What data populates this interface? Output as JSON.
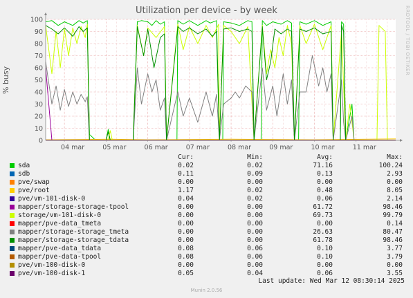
{
  "title": "Utilization per device - by week",
  "side_label": "RRDTOOL / TOBI OETIKER",
  "legend_headers": {
    "cur": "Cur:",
    "min": "Min:",
    "avg": "Avg:",
    "max": "Max:"
  },
  "legend": [
    {
      "name": "sda",
      "color": "#00cc00",
      "cur": "0.02",
      "min": "0.02",
      "avg": "71.16",
      "max": "100.24"
    },
    {
      "name": "sdb",
      "color": "#0066b3",
      "cur": "0.11",
      "min": "0.09",
      "avg": "0.13",
      "max": "2.93"
    },
    {
      "name": "pve/swap",
      "color": "#ff8000",
      "cur": "0.00",
      "min": "0.00",
      "avg": "0.00",
      "max": "0.00"
    },
    {
      "name": "pve/root",
      "color": "#ffcc00",
      "cur": "1.17",
      "min": "0.02",
      "avg": "0.48",
      "max": "8.05"
    },
    {
      "name": "pve/vm-101-disk-0",
      "color": "#330099",
      "cur": "0.04",
      "min": "0.02",
      "avg": "0.06",
      "max": "2.14"
    },
    {
      "name": "mapper/storage-storage-tpool",
      "color": "#990099",
      "cur": "0.00",
      "min": "0.00",
      "avg": "61.72",
      "max": "98.46"
    },
    {
      "name": "storage/vm-101-disk-0",
      "color": "#ccff00",
      "cur": "0.00",
      "min": "0.00",
      "avg": "69.73",
      "max": "99.79"
    },
    {
      "name": "mapper/pve-data_tmeta",
      "color": "#ff0000",
      "cur": "0.00",
      "min": "0.00",
      "avg": "0.00",
      "max": "0.14"
    },
    {
      "name": "mapper/storage-storage_tmeta",
      "color": "#808080",
      "cur": "0.00",
      "min": "0.00",
      "avg": "26.63",
      "max": "80.47"
    },
    {
      "name": "mapper/storage-storage_tdata",
      "color": "#008f00",
      "cur": "0.00",
      "min": "0.00",
      "avg": "61.78",
      "max": "98.46"
    },
    {
      "name": "mapper/pve-data_tdata",
      "color": "#00487d",
      "cur": "0.08",
      "min": "0.06",
      "avg": "0.10",
      "max": "3.77"
    },
    {
      "name": "mapper/pve-data-tpool",
      "color": "#b35a00",
      "cur": "0.08",
      "min": "0.06",
      "avg": "0.10",
      "max": "3.79"
    },
    {
      "name": "pve/vm-100-disk-0",
      "color": "#b38f00",
      "cur": "0.00",
      "min": "0.00",
      "avg": "0.00",
      "max": "0.00"
    },
    {
      "name": "pve/vm-100-disk-1",
      "color": "#6b006b",
      "cur": "0.05",
      "min": "0.04",
      "avg": "0.06",
      "max": "3.55"
    }
  ],
  "last_update": "Last update: Wed Mar 12 08:30:14 2025",
  "footer": "Munin 2.0.56",
  "chart_data": {
    "type": "line",
    "title": "Utilization per device - by week",
    "ylabel": "% busy",
    "ylim": [
      0,
      100
    ],
    "yticks": [
      0,
      10,
      20,
      30,
      40,
      50,
      60,
      70,
      80,
      90,
      100
    ],
    "xlim": [
      3.55,
      11.95
    ],
    "xticks": [
      {
        "label": "04 mar",
        "x": 4
      },
      {
        "label": "05 mar",
        "x": 5
      },
      {
        "label": "06 mar",
        "x": 6
      },
      {
        "label": "07 mar",
        "x": 7
      },
      {
        "label": "08 mar",
        "x": 8
      },
      {
        "label": "09 mar",
        "x": 9
      },
      {
        "label": "10 mar",
        "x": 10
      },
      {
        "label": "11 mar",
        "x": 11
      }
    ],
    "grid": true,
    "series": [
      {
        "name": "sda",
        "color": "#00cc00",
        "points": [
          [
            3.55,
            98
          ],
          [
            3.7,
            99
          ],
          [
            3.85,
            95
          ],
          [
            4.0,
            98
          ],
          [
            4.2,
            95
          ],
          [
            4.35,
            99
          ],
          [
            4.45,
            97
          ],
          [
            4.55,
            99
          ],
          [
            4.6,
            5
          ],
          [
            4.75,
            0
          ],
          [
            4.9,
            0
          ],
          [
            5.0,
            0
          ],
          [
            5.05,
            9
          ],
          [
            5.1,
            0
          ],
          [
            5.4,
            0
          ],
          [
            5.65,
            0
          ],
          [
            5.75,
            98
          ],
          [
            5.85,
            99
          ],
          [
            6.0,
            98
          ],
          [
            6.1,
            95
          ],
          [
            6.2,
            99
          ],
          [
            6.3,
            96
          ],
          [
            6.4,
            98
          ],
          [
            6.45,
            0
          ],
          [
            6.7,
            0
          ],
          [
            6.72,
            99
          ],
          [
            6.85,
            96
          ],
          [
            7.0,
            99
          ],
          [
            7.2,
            95
          ],
          [
            7.4,
            99
          ],
          [
            7.5,
            97
          ],
          [
            7.65,
            99
          ],
          [
            7.72,
            0
          ],
          [
            7.8,
            0
          ],
          [
            7.82,
            98
          ],
          [
            8.0,
            97
          ],
          [
            8.2,
            95
          ],
          [
            8.4,
            99
          ],
          [
            8.5,
            98
          ],
          [
            8.55,
            0
          ],
          [
            8.72,
            0
          ],
          [
            8.75,
            99
          ],
          [
            8.85,
            95
          ],
          [
            9.0,
            98
          ],
          [
            9.2,
            96
          ],
          [
            9.35,
            99
          ],
          [
            9.45,
            97
          ],
          [
            9.52,
            0
          ],
          [
            9.62,
            0
          ],
          [
            9.65,
            98
          ],
          [
            9.8,
            96
          ],
          [
            10.0,
            99
          ],
          [
            10.2,
            95
          ],
          [
            10.4,
            98
          ],
          [
            10.45,
            0
          ],
          [
            10.62,
            0
          ],
          [
            10.65,
            98
          ],
          [
            10.7,
            96
          ],
          [
            10.75,
            0
          ],
          [
            10.9,
            30
          ],
          [
            10.95,
            0
          ],
          [
            11.3,
            0
          ],
          [
            11.95,
            0
          ]
        ]
      },
      {
        "name": "sdb",
        "color": "#0066b3",
        "points": [
          [
            3.55,
            0.2
          ],
          [
            11.95,
            0.2
          ]
        ]
      },
      {
        "name": "pve/swap",
        "color": "#ff8000",
        "points": [
          [
            3.55,
            0
          ],
          [
            11.95,
            0
          ]
        ]
      },
      {
        "name": "pve/root",
        "color": "#ffcc00",
        "points": [
          [
            3.55,
            0.5
          ],
          [
            5.1,
            1
          ],
          [
            6.0,
            0.5
          ],
          [
            8.0,
            1
          ],
          [
            10.0,
            0.5
          ],
          [
            11.95,
            1.2
          ]
        ]
      },
      {
        "name": "pve/vm-101-disk-0",
        "color": "#330099",
        "points": [
          [
            3.55,
            0.1
          ],
          [
            11.95,
            0.1
          ]
        ]
      },
      {
        "name": "mapper/storage-storage-tpool",
        "color": "#990099",
        "points": [
          [
            3.55,
            60
          ],
          [
            3.7,
            0
          ],
          [
            11.95,
            0
          ]
        ]
      },
      {
        "name": "storage/vm-101-disk-0",
        "color": "#ccff00",
        "points": [
          [
            3.55,
            95
          ],
          [
            3.7,
            55
          ],
          [
            3.8,
            90
          ],
          [
            3.9,
            60
          ],
          [
            4.0,
            92
          ],
          [
            4.1,
            70
          ],
          [
            4.2,
            93
          ],
          [
            4.3,
            80
          ],
          [
            4.4,
            94
          ],
          [
            4.5,
            85
          ],
          [
            4.55,
            96
          ],
          [
            4.6,
            0
          ],
          [
            5.05,
            0
          ],
          [
            5.1,
            8
          ],
          [
            5.15,
            0
          ],
          [
            5.65,
            0
          ],
          [
            5.75,
            95
          ],
          [
            5.9,
            70
          ],
          [
            6.0,
            93
          ],
          [
            6.2,
            85
          ],
          [
            6.4,
            94
          ],
          [
            6.45,
            0
          ],
          [
            6.72,
            96
          ],
          [
            6.85,
            75
          ],
          [
            7.0,
            94
          ],
          [
            7.2,
            80
          ],
          [
            7.4,
            95
          ],
          [
            7.55,
            85
          ],
          [
            7.7,
            96
          ],
          [
            7.72,
            0
          ],
          [
            7.82,
            95
          ],
          [
            8.0,
            90
          ],
          [
            8.2,
            80
          ],
          [
            8.4,
            94
          ],
          [
            8.55,
            0
          ],
          [
            8.75,
            95
          ],
          [
            8.85,
            55
          ],
          [
            8.95,
            75
          ],
          [
            9.05,
            60
          ],
          [
            9.15,
            85
          ],
          [
            9.25,
            70
          ],
          [
            9.35,
            95
          ],
          [
            9.45,
            80
          ],
          [
            9.52,
            0
          ],
          [
            9.65,
            95
          ],
          [
            9.8,
            80
          ],
          [
            10.0,
            96
          ],
          [
            10.2,
            75
          ],
          [
            10.4,
            95
          ],
          [
            10.45,
            0
          ],
          [
            10.65,
            90
          ],
          [
            10.75,
            0
          ],
          [
            10.85,
            30
          ],
          [
            10.9,
            15
          ],
          [
            10.95,
            0
          ],
          [
            11.5,
            0
          ],
          [
            11.55,
            95
          ],
          [
            11.7,
            90
          ],
          [
            11.75,
            0
          ],
          [
            11.95,
            0
          ]
        ]
      },
      {
        "name": "mapper/pve-data_tmeta",
        "color": "#ff0000",
        "points": [
          [
            3.55,
            0
          ],
          [
            11.95,
            0
          ]
        ]
      },
      {
        "name": "mapper/storage-storage_tmeta",
        "color": "#808080",
        "points": [
          [
            3.55,
            65
          ],
          [
            3.7,
            30
          ],
          [
            3.8,
            45
          ],
          [
            3.9,
            25
          ],
          [
            4.0,
            42
          ],
          [
            4.1,
            28
          ],
          [
            4.2,
            40
          ],
          [
            4.3,
            30
          ],
          [
            4.4,
            38
          ],
          [
            4.5,
            32
          ],
          [
            4.55,
            36
          ],
          [
            4.6,
            0
          ],
          [
            5.65,
            0
          ],
          [
            5.75,
            60
          ],
          [
            5.85,
            30
          ],
          [
            6.0,
            55
          ],
          [
            6.1,
            40
          ],
          [
            6.2,
            50
          ],
          [
            6.3,
            25
          ],
          [
            6.4,
            35
          ],
          [
            6.45,
            0
          ],
          [
            6.72,
            40
          ],
          [
            6.85,
            20
          ],
          [
            7.0,
            35
          ],
          [
            7.2,
            15
          ],
          [
            7.4,
            40
          ],
          [
            7.55,
            20
          ],
          [
            7.65,
            38
          ],
          [
            7.72,
            0
          ],
          [
            7.82,
            30
          ],
          [
            8.0,
            35
          ],
          [
            8.1,
            40
          ],
          [
            8.2,
            35
          ],
          [
            8.35,
            45
          ],
          [
            8.5,
            40
          ],
          [
            8.55,
            0
          ],
          [
            8.75,
            60
          ],
          [
            8.85,
            25
          ],
          [
            9.0,
            45
          ],
          [
            9.1,
            20
          ],
          [
            9.25,
            55
          ],
          [
            9.35,
            30
          ],
          [
            9.45,
            50
          ],
          [
            9.52,
            0
          ],
          [
            9.65,
            40
          ],
          [
            9.8,
            40
          ],
          [
            9.95,
            70
          ],
          [
            10.1,
            45
          ],
          [
            10.2,
            60
          ],
          [
            10.3,
            40
          ],
          [
            10.4,
            55
          ],
          [
            10.45,
            0
          ],
          [
            10.65,
            50
          ],
          [
            10.7,
            15
          ],
          [
            10.75,
            0
          ],
          [
            10.9,
            20
          ],
          [
            10.95,
            0
          ],
          [
            11.95,
            0
          ]
        ]
      },
      {
        "name": "mapper/storage-storage_tdata",
        "color": "#008f00",
        "points": [
          [
            3.55,
            95
          ],
          [
            3.7,
            92
          ],
          [
            3.85,
            88
          ],
          [
            4.0,
            93
          ],
          [
            4.2,
            86
          ],
          [
            4.35,
            94
          ],
          [
            4.45,
            90
          ],
          [
            4.55,
            93
          ],
          [
            4.6,
            0
          ],
          [
            5.0,
            0
          ],
          [
            5.05,
            7
          ],
          [
            5.1,
            0
          ],
          [
            5.65,
            0
          ],
          [
            5.75,
            94
          ],
          [
            5.9,
            70
          ],
          [
            6.0,
            92
          ],
          [
            6.15,
            60
          ],
          [
            6.3,
            85
          ],
          [
            6.4,
            88
          ],
          [
            6.45,
            0
          ],
          [
            6.72,
            94
          ],
          [
            6.85,
            90
          ],
          [
            7.0,
            93
          ],
          [
            7.2,
            88
          ],
          [
            7.4,
            92
          ],
          [
            7.55,
            86
          ],
          [
            7.65,
            90
          ],
          [
            7.72,
            0
          ],
          [
            7.82,
            92
          ],
          [
            8.0,
            93
          ],
          [
            8.2,
            90
          ],
          [
            8.4,
            92
          ],
          [
            8.5,
            90
          ],
          [
            8.55,
            0
          ],
          [
            8.75,
            94
          ],
          [
            8.85,
            50
          ],
          [
            8.95,
            65
          ],
          [
            9.05,
            92
          ],
          [
            9.2,
            88
          ],
          [
            9.35,
            92
          ],
          [
            9.45,
            90
          ],
          [
            9.52,
            0
          ],
          [
            9.65,
            92
          ],
          [
            9.8,
            90
          ],
          [
            10.0,
            93
          ],
          [
            10.2,
            88
          ],
          [
            10.4,
            90
          ],
          [
            10.45,
            0
          ],
          [
            10.62,
            0
          ],
          [
            10.65,
            95
          ],
          [
            10.7,
            90
          ],
          [
            10.75,
            0
          ],
          [
            11.95,
            0
          ]
        ]
      },
      {
        "name": "mapper/pve-data_tdata",
        "color": "#00487d",
        "points": [
          [
            3.55,
            0.1
          ],
          [
            11.95,
            0.1
          ]
        ]
      },
      {
        "name": "mapper/pve-data-tpool",
        "color": "#b35a00",
        "points": [
          [
            3.55,
            0.1
          ],
          [
            11.95,
            0.1
          ]
        ]
      },
      {
        "name": "pve/vm-100-disk-0",
        "color": "#b38f00",
        "points": [
          [
            3.55,
            0
          ],
          [
            11.95,
            0
          ]
        ]
      },
      {
        "name": "pve/vm-100-disk-1",
        "color": "#6b006b",
        "points": [
          [
            3.55,
            0.1
          ],
          [
            11.95,
            0.1
          ]
        ]
      }
    ]
  }
}
